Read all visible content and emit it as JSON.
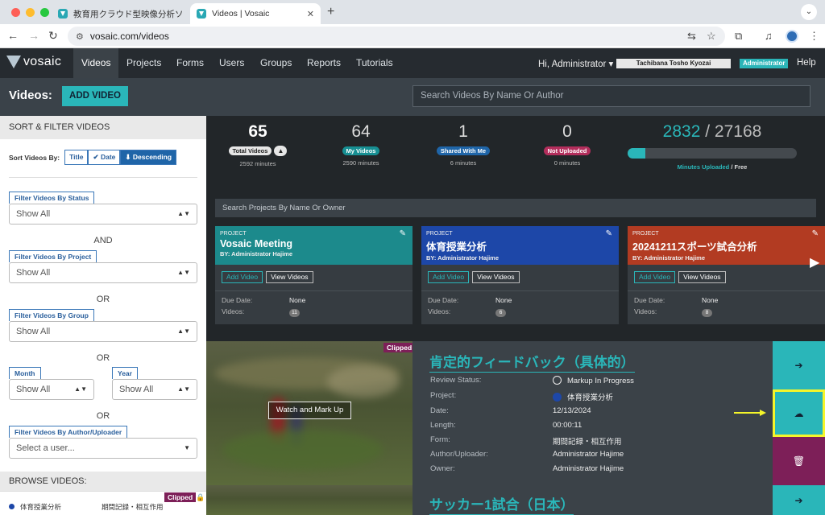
{
  "browser": {
    "tabs": [
      {
        "title": "教育用クラウド型映像分析ソフト"
      },
      {
        "title": "Videos | Vosaic"
      }
    ],
    "url": "vosaic.com/videos"
  },
  "nav": {
    "logo": "vosaic",
    "items": [
      "Videos",
      "Projects",
      "Forms",
      "Users",
      "Groups",
      "Reports",
      "Tutorials"
    ],
    "greeting": "Hi, Administrator ▾",
    "org_name": "Tachibana Tosho Kyozai",
    "role_badge": "Administrator",
    "help": "Help"
  },
  "header": {
    "title": "Videos:",
    "add_button": "ADD VIDEO",
    "search_placeholder": "Search Videos By Name Or Author"
  },
  "sidebar": {
    "sort_filter_title": "SORT & FILTER VIDEOS",
    "sort_label": "Sort Videos By:",
    "sort_buttons": [
      "Title",
      "Date",
      "Descending"
    ],
    "filters": {
      "status": {
        "label": "Filter Videos By Status",
        "value": "Show All"
      },
      "project": {
        "label": "Filter Videos By Project",
        "value": "Show All"
      },
      "group": {
        "label": "Filter Videos By Group",
        "value": "Show All"
      },
      "month": {
        "label": "Month",
        "value": "Show All"
      },
      "year": {
        "label": "Year",
        "value": "Show All"
      },
      "author": {
        "label": "Filter Videos By Author/Uploader",
        "placeholder": "Select a user..."
      }
    },
    "conj": {
      "and": "AND",
      "or": "OR"
    },
    "browse_title": "BROWSE VIDEOS:",
    "browse_item": {
      "project": "体育授業分析",
      "form": "期間記録・相互作用",
      "clipped": "Clipped"
    }
  },
  "stats": {
    "total": {
      "num": "65",
      "label": "Total Videos",
      "sub": "2592 minutes"
    },
    "mine": {
      "num": "64",
      "label": "My Videos",
      "sub": "2590 minutes"
    },
    "shared": {
      "num": "1",
      "label": "Shared With Me",
      "sub": "6 minutes"
    },
    "not_uploaded": {
      "num": "0",
      "label": "Not Uploaded",
      "sub": "0 minutes"
    },
    "minutes": {
      "used": "2832",
      "sep": " / ",
      "total": "27168",
      "fraction": 0.104,
      "uploaded_label": "Minutes Uploaded",
      "free_label": " / Free"
    }
  },
  "projects": {
    "search_placeholder": "Search Projects By Name Or Owner",
    "cards": [
      {
        "kicker": "PROJECT",
        "title": "Vosaic Meeting",
        "by": "BY: Administrator Hajime",
        "add": "Add Video",
        "view": "View Videos",
        "due_label": "Due Date:",
        "due": "None",
        "videos_label": "Videos:",
        "videos": "11",
        "color": "#1c8a8c"
      },
      {
        "kicker": "PROJECT",
        "title": "体育授業分析",
        "by": "BY: Administrator Hajime",
        "add": "Add Video",
        "view": "View Videos",
        "due_label": "Due Date:",
        "due": "None",
        "videos_label": "Videos:",
        "videos": "6",
        "color": "#1d47a8"
      },
      {
        "kicker": "PROJECT",
        "title": "20241211スポーツ試合分析",
        "by": "BY: Administrator Hajime",
        "add": "Add Video",
        "view": "View Videos",
        "due_label": "Due Date:",
        "due": "None",
        "videos_label": "Videos:",
        "videos": "8",
        "color": "#b23b22"
      }
    ]
  },
  "video": {
    "clipped": "Clipped",
    "watch": "Watch and Mark Up",
    "title": "肯定的フィードバック（具体的）",
    "review_status_label": "Review Status:",
    "review_status": "Markup In Progress",
    "project_label": "Project:",
    "project": "体育授業分析",
    "date_label": "Date:",
    "date": "12/13/2024",
    "length_label": "Length:",
    "length": "00:00:11",
    "form_label": "Form:",
    "form": "期間記録・相互作用",
    "author_label": "Author/Uploader:",
    "author": "Administrator Hajime",
    "owner_label": "Owner:",
    "owner": "Administrator Hajime"
  },
  "video2": {
    "title": "サッカー1試合（日本）"
  },
  "icons": {
    "open": "arrow-right-icon",
    "share": "cloud-share-icon",
    "delete": "trash-icon"
  },
  "colors": {
    "accent": "#2ab6b9",
    "nav": "#262b30",
    "danger": "#7d1f58",
    "highlight": "#f5f52a"
  }
}
